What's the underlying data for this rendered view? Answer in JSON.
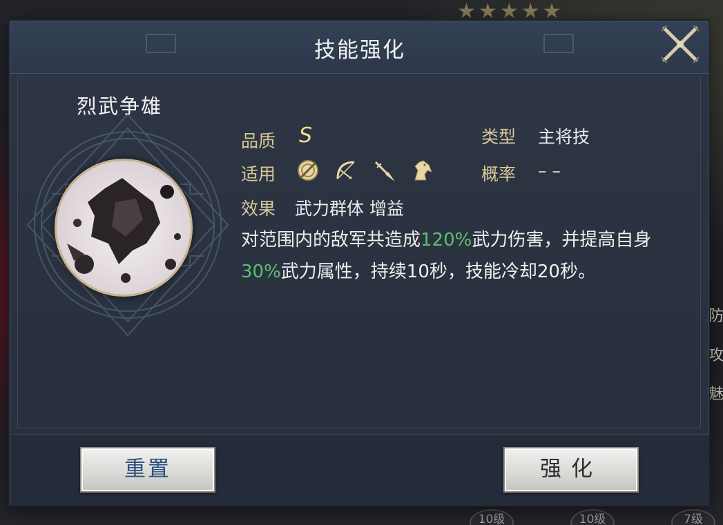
{
  "background": {
    "stars": [
      "★",
      "★",
      "★",
      "★",
      "★"
    ],
    "side_text": [
      "防",
      "攻",
      "魅"
    ],
    "levels": [
      "10级",
      "10级",
      "7级"
    ]
  },
  "dialog": {
    "title": "技能强化",
    "close_icon": "crossed-swords-close-icon"
  },
  "skill": {
    "name": "烈武争雄",
    "quality_label": "品质",
    "quality_value": "S",
    "type_label": "类型",
    "type_value": "主将技",
    "applicable_label": "适用",
    "applicable_icons": [
      "shield-icon",
      "bow-icon",
      "spear-icon",
      "horse-icon"
    ],
    "chance_label": "概率",
    "chance_value": "– –",
    "effect_label": "效果",
    "effect_value": "武力群体 增益",
    "desc": {
      "p1": "对范围内的敌军共造成",
      "v1": "120%",
      "p2": "武力伤害，并提高自身",
      "v2": "30%",
      "p3": "武力属性，持续10秒，技能冷却20秒。"
    },
    "highlight_color": "#5cc06c",
    "label_color": "#d9c79a"
  },
  "footer": {
    "reset_label": "重置",
    "enhance_label": "强化"
  }
}
